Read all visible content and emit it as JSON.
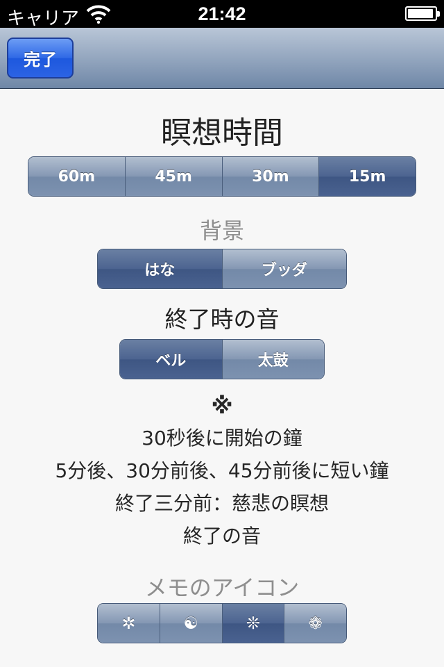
{
  "status_bar": {
    "carrier": "キャリア",
    "time": "21:42"
  },
  "nav": {
    "done_label": "完了"
  },
  "meditation_time": {
    "title": "瞑想時間",
    "options": [
      "60m",
      "45m",
      "30m",
      "15m"
    ],
    "selected": "15m"
  },
  "background": {
    "title": "背景",
    "options": [
      "はな",
      "ブッダ"
    ],
    "selected": "はな"
  },
  "end_sound": {
    "title": "終了時の音",
    "options": [
      "ベル",
      "太鼓"
    ],
    "selected": "ベル"
  },
  "notes": {
    "mark": "※",
    "lines": [
      "30秒後に開始の鐘",
      "5分後、30分前後、45分前後に短い鐘",
      "終了三分前：慈悲の瞑想",
      "終了の音"
    ]
  },
  "memo_icon": {
    "title": "メモのアイコン",
    "options": [
      "✲",
      "☯",
      "❊",
      "❁"
    ],
    "option_icons": [
      "asterisk-icon",
      "yin-yang-icon",
      "sparkle-icon",
      "flower-icon"
    ],
    "selected": "❊"
  },
  "colors": {
    "segment_selected": "#3e5683",
    "segment_normal": "#8497b3",
    "done_button": "#2f69e6"
  }
}
